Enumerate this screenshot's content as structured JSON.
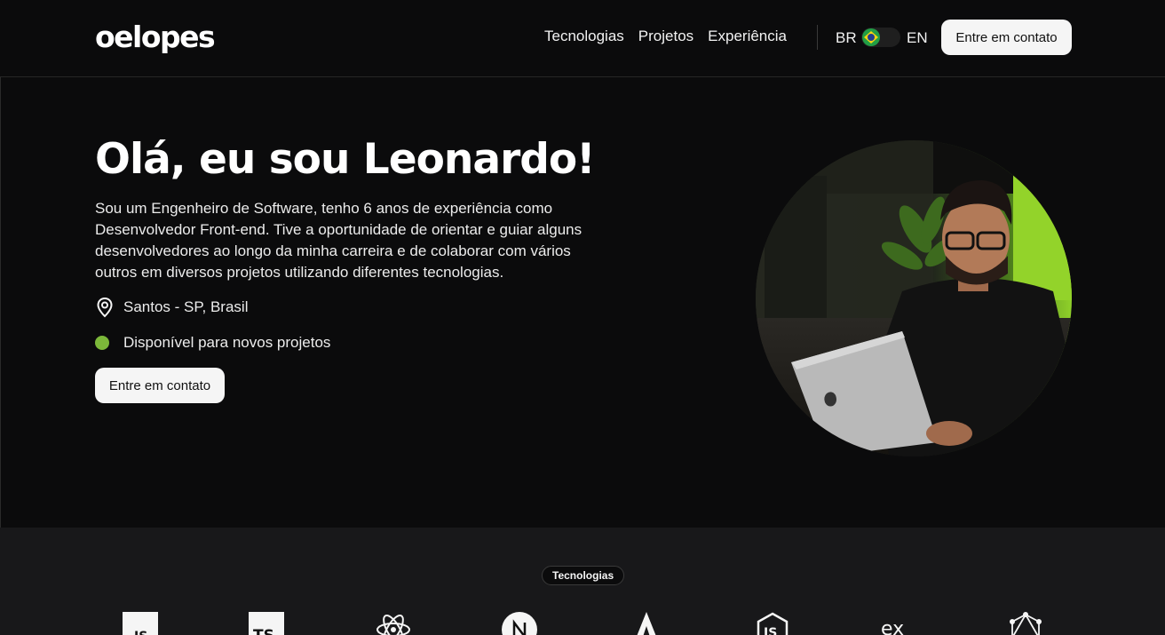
{
  "header": {
    "logo": "oelopes",
    "nav": [
      "Tecnologias",
      "Projetos",
      "Experiência"
    ],
    "lang_br": "BR",
    "lang_en": "EN",
    "cta": "Entre em contato"
  },
  "hero": {
    "title": "Olá, eu sou Leonardo!",
    "description": "Sou um Engenheiro de Software, tenho 6 anos de experiência como Desenvolvedor Front-end. Tive a oportunidade de orientar e guiar alguns desenvolvedores ao longo da minha carreira e de colaborar com vários outros em diversos projetos utilizando diferentes tecnologias.",
    "location": "Santos - SP, Brasil",
    "availability": "Disponível para novos projetos",
    "cta": "Entre em contato"
  },
  "technologies": {
    "badge": "Tecnologias",
    "icons": [
      "javascript-icon",
      "typescript-icon",
      "react-icon",
      "nextjs-icon",
      "angular-icon",
      "nodejs-icon",
      "express-icon",
      "graphql-icon"
    ]
  },
  "colors": {
    "background": "#0b0b0c",
    "section_background": "#18181a",
    "available_dot": "#7cb83a",
    "button_background": "#f5f5f5"
  }
}
